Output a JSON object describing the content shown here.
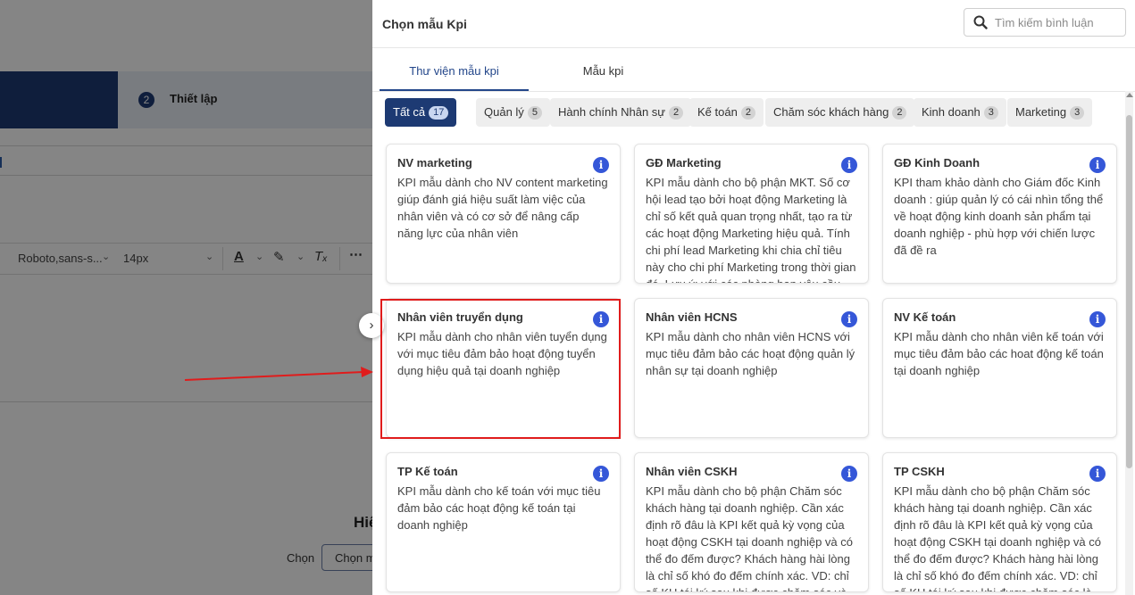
{
  "background": {
    "step_number": "2",
    "step_label": "Thiết lập",
    "toolbar": {
      "font_family": "Roboto,sans-s...",
      "font_size": "14px"
    },
    "heading_partial": "Hiệ",
    "select_label": "Chọn",
    "select_button_partial": "Chọn m"
  },
  "drawer": {
    "title": "Chọn mẫu Kpi",
    "search": {
      "placeholder": "Tìm kiếm bình luận"
    },
    "tabs": [
      {
        "label": "Thư viện mẫu kpi",
        "active": true
      },
      {
        "label": "Mẫu kpi",
        "active": false
      }
    ],
    "filters": [
      {
        "label": "Tất cả",
        "count": "17",
        "active": true
      },
      {
        "label": "Quản lý",
        "count": "5"
      },
      {
        "label": "Hành chính Nhân sự",
        "count": "2"
      },
      {
        "label": "Kế toán",
        "count": "2"
      },
      {
        "label": "Chăm sóc khách hàng",
        "count": "2"
      },
      {
        "label": "Kinh doanh",
        "count": "3"
      },
      {
        "label": "Marketing",
        "count": "3"
      }
    ],
    "cards": [
      {
        "title": "NV marketing",
        "desc": "KPI mẫu dành cho NV content marketing giúp đánh giá hiệu suất làm việc của nhân viên và có cơ sở để nâng cấp năng lực của nhân viên"
      },
      {
        "title": "GĐ Marketing",
        "desc": "KPI mẫu dành cho bộ phận MKT. Số cơ hội lead tạo bởi hoạt động Marketing là chỉ số kết quả quan trọng nhất, tạo ra từ các hoạt động Marketing hiệu quả. Tính chi phí lead Marketing khi chia chỉ tiêu này cho chi phí Marketing trong thời gian đó. Lưu ý: với các phòng ban yêu cầu tính sáng tạo nhất"
      },
      {
        "title": "GĐ Kinh Doanh",
        "desc": "KPI tham khảo dành cho Giám đốc Kinh doanh : giúp quản lý có cái nhìn tổng thể về hoạt động kinh doanh sản phẩm tại doanh nghiệp - phù hợp với chiến lược đã đề ra"
      },
      {
        "title": "Nhân viên truyển dụng",
        "desc": "KPI mẫu dành cho nhân viên tuyển dụng với mục tiêu đảm bảo hoạt động tuyển dụng hiệu quả tại doanh nghiệp"
      },
      {
        "title": "Nhân viên HCNS",
        "desc": "KPI mẫu dành cho nhân viên HCNS với mục tiêu đảm bảo các hoạt động quản lý nhân sự tại doanh nghiệp"
      },
      {
        "title": "NV Kế toán",
        "desc": "KPI mẫu dành cho nhân viên kế toán với mục tiêu đảm bảo các hoat động kế toán tại doanh nghiệp"
      },
      {
        "title": "TP Kế toán",
        "desc": "KPI mẫu dành cho kế toán với mục tiêu đảm bảo các hoạt động kế toán tại doanh nghiệp"
      },
      {
        "title": "Nhân viên CSKH",
        "desc": "KPI mẫu dành cho bộ phận Chăm sóc khách hàng tại doanh nghiệp. Cần xác định rõ đâu là KPI kết quả kỳ vọng của hoạt động CSKH tại doanh nghiệp và có thể đo đếm được? Khách hàng hài lòng là chỉ số khó đo đếm chính xác. VD: chỉ số KH tái ký sau khi được chăm sóc và mua thêm. KH"
      },
      {
        "title": "TP CSKH",
        "desc": "KPI mẫu dành cho bộ phận Chăm sóc khách hàng tại doanh nghiệp. Cần xác định rõ đâu là KPI kết quả kỳ vọng của hoạt động CSKH tại doanh nghiệp và có thể đo đếm được? Khách hàng hài lòng là chỉ số khó đo đếm chính xác. VD: chỉ số KH tái ký sau khi được chăm sóc là một chỉ số kết"
      }
    ],
    "info_glyph": "i"
  },
  "colors": {
    "primary": "#1d3a73",
    "accent": "#23468a",
    "info": "#3557d8",
    "annotation": "#e01c1c"
  }
}
